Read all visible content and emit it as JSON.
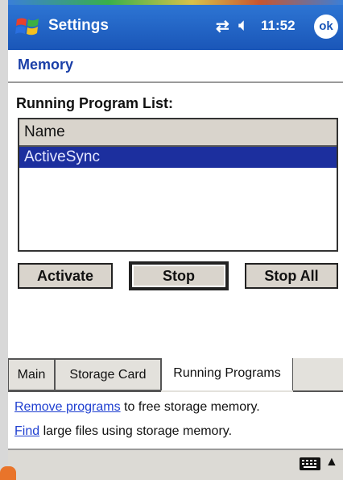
{
  "titlebar": {
    "title": "Settings",
    "time": "11:52",
    "ok_label": "ok"
  },
  "icons": {
    "start": "windows-flag-icon",
    "connectivity": "connectivity-icon",
    "volume": "speaker-icon",
    "keyboard": "keyboard-icon",
    "sip_arrow": "up-arrow-icon"
  },
  "page": {
    "title": "Memory"
  },
  "running_list": {
    "label": "Running Program List:",
    "column_header": "Name",
    "items": [
      "ActiveSync"
    ],
    "selected": "ActiveSync"
  },
  "buttons": {
    "activate": "Activate",
    "stop": "Stop",
    "stop_all": "Stop All"
  },
  "tabs": {
    "main": "Main",
    "storage_card": "Storage Card",
    "running_programs": "Running Programs",
    "active": "Running Programs"
  },
  "info": {
    "line1_link": "Remove programs",
    "line1_text": " to free storage memory.",
    "line2_link": "Find",
    "line2_text": " large files using storage memory."
  },
  "colors": {
    "titlebar": "#1a56b8",
    "selection": "#1c2f9e",
    "link": "#1f3fd0",
    "page_title": "#1a3fa8"
  }
}
